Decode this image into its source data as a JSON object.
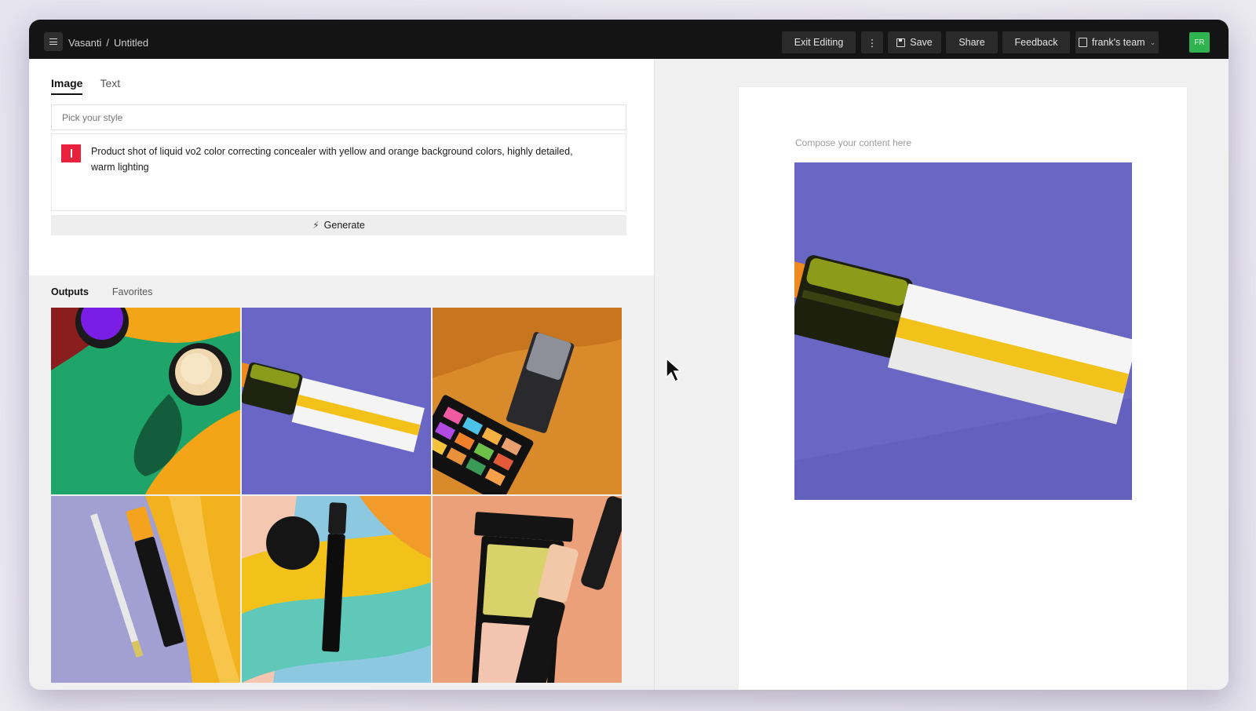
{
  "topbar": {
    "menu_icon": "hamburger-icon",
    "breadcrumb": {
      "workspace": "Vasanti",
      "separator": "/",
      "document": "Untitled"
    },
    "buttons": {
      "exit_editing": "Exit Editing",
      "more": "⋮",
      "save": "Save",
      "share": "Share",
      "feedback": "Feedback",
      "team": "frank's team"
    },
    "avatar_initials": "FR",
    "avatar_color": "#2fb350"
  },
  "editor": {
    "tabs": [
      {
        "label": "Image",
        "active": true
      },
      {
        "label": "Text",
        "active": false
      }
    ],
    "style_placeholder": "Pick your style",
    "prompt": "Product shot of liquid vo2 color correcting concealer with yellow and orange background colors, highly detailed, warm lighting",
    "prompt_badge_color": "#e8223c",
    "generate_label": "Generate",
    "generate_icon": "magic-wand-icon"
  },
  "outputs": {
    "tabs": [
      {
        "label": "Outputs",
        "active": true
      },
      {
        "label": "Favorites",
        "active": false
      }
    ],
    "images": [
      "Cosmetic jars on orange and green background",
      "Concealer tube on purple background",
      "Eyeshadow palette on orange background",
      "Pencils and lip product on purple and yellow background",
      "Mascara and sponge on teal and yellow background",
      "Concealer compact on peach background"
    ]
  },
  "canvas": {
    "hint": "Compose your content here",
    "selected_image": "Concealer tube on purple background"
  },
  "colors": {
    "topbar_bg": "#141414",
    "accent_purple": "#6a66c6"
  }
}
